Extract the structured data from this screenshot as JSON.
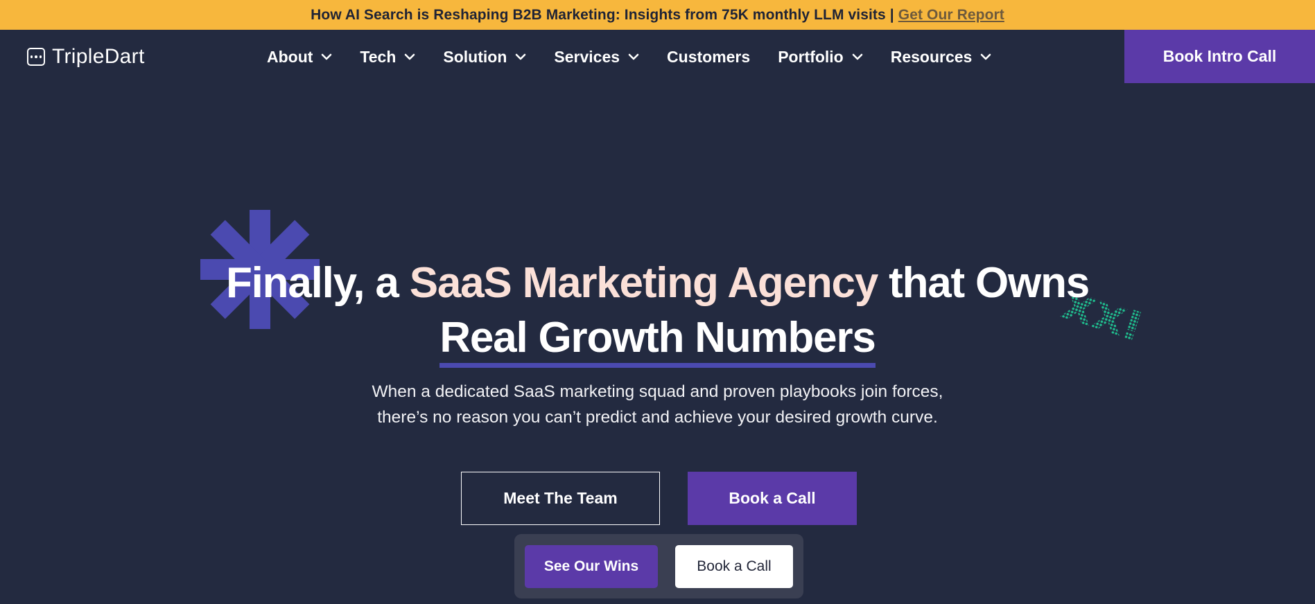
{
  "announcement": {
    "text": "How AI Search is Reshaping B2B Marketing: Insights from 75K monthly LLM visits",
    "separator": "|",
    "link_label": "Get Our Report"
  },
  "brand": {
    "name": "TripleDart"
  },
  "nav": {
    "items": [
      {
        "label": "About",
        "has_dropdown": true
      },
      {
        "label": "Tech",
        "has_dropdown": true
      },
      {
        "label": "Solution",
        "has_dropdown": true
      },
      {
        "label": "Services",
        "has_dropdown": true
      },
      {
        "label": "Customers",
        "has_dropdown": false
      },
      {
        "label": "Portfolio",
        "has_dropdown": true
      },
      {
        "label": "Resources",
        "has_dropdown": true
      }
    ],
    "cta_label": "Book Intro Call"
  },
  "hero": {
    "title_part1": "Finally, a ",
    "title_accent": "SaaS Marketing Agency",
    "title_part2": " that Owns",
    "title_line2": "Real Growth Numbers",
    "subtitle_line1": "When a dedicated SaaS marketing squad and proven playbooks join forces,",
    "subtitle_line2": "there’s no reason you can’t predict and achieve your desired growth curve.",
    "primary_outline_label": "Meet The Team",
    "primary_cta_label": "Book a Call"
  },
  "floating_bar": {
    "wins_label": "See Our Wins",
    "call_label": "Book a Call"
  },
  "colors": {
    "announcement_bg": "#f7b73d",
    "page_bg": "#232a40",
    "brand_purple": "#5b3aa8",
    "accent_text": "#fbe0d8",
    "asterisk": "#4b4ab0",
    "deco_green": "#1fbf8f"
  }
}
